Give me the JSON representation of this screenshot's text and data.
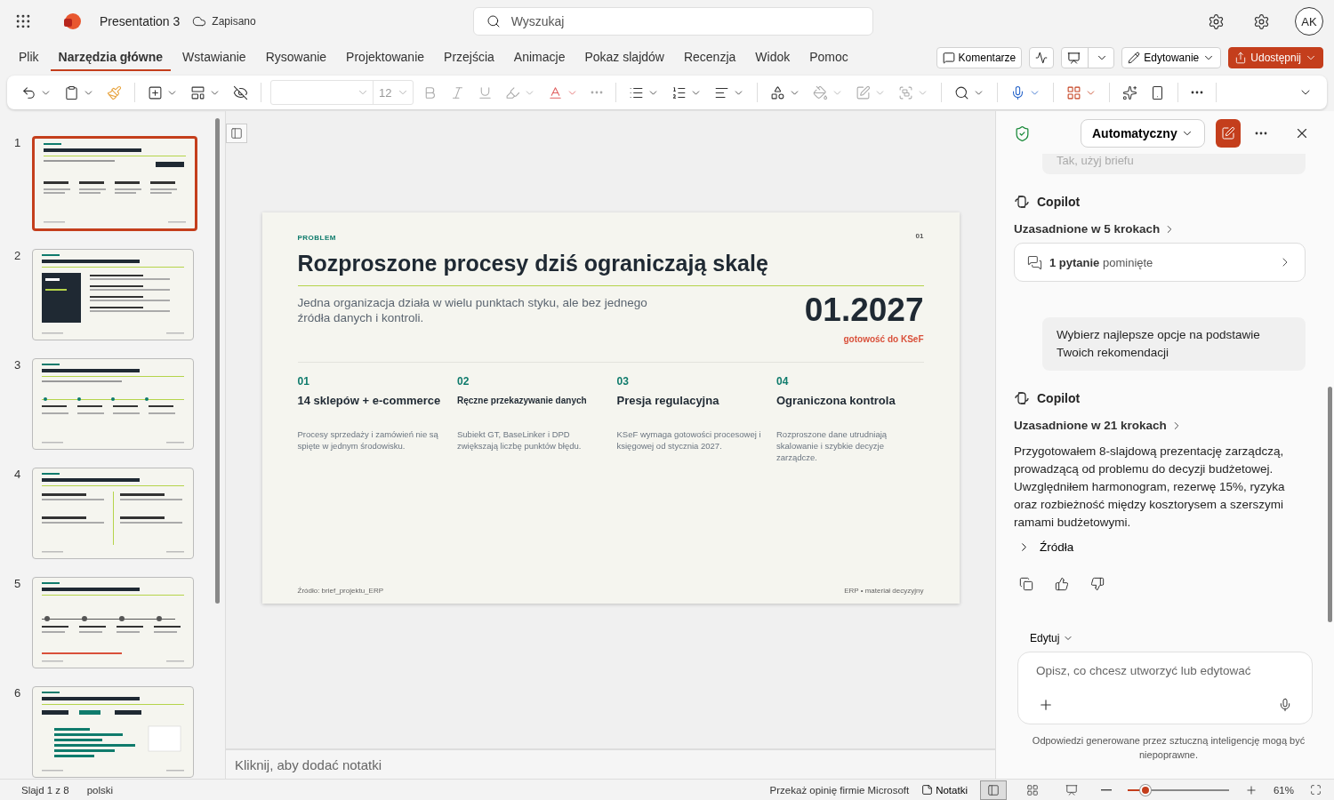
{
  "app": {
    "title": "Presentation 3",
    "save_status": "Zapisano",
    "search": {
      "placeholder": "Wyszukaj"
    },
    "avatar": "AK"
  },
  "menu_tabs": [
    {
      "label": "Plik",
      "selected": false
    },
    {
      "label": "Narzędzia główne",
      "selected": true
    },
    {
      "label": "Wstawianie",
      "selected": false
    },
    {
      "label": "Rysowanie",
      "selected": false
    },
    {
      "label": "Projektowanie",
      "selected": false
    },
    {
      "label": "Przejścia",
      "selected": false
    },
    {
      "label": "Animacje",
      "selected": false
    },
    {
      "label": "Pokaz slajdów",
      "selected": false
    },
    {
      "label": "Recenzja",
      "selected": false
    },
    {
      "label": "Widok",
      "selected": false
    },
    {
      "label": "Pomoc",
      "selected": false
    }
  ],
  "header_buttons": {
    "comments": "Komentarze",
    "mode": "Edytowanie",
    "share": "Udostępnij"
  },
  "toolbar": {
    "font_size": "12"
  },
  "slides": [
    {
      "number": "1",
      "selected": true
    },
    {
      "number": "2",
      "selected": false
    },
    {
      "number": "3",
      "selected": false
    },
    {
      "number": "4",
      "selected": false
    },
    {
      "number": "5",
      "selected": false
    },
    {
      "number": "6",
      "selected": false
    }
  ],
  "slide": {
    "label": "PROBLEM",
    "page": "01",
    "title": "Rozproszone procesy dziś ograniczają skalę",
    "subtitle": "Jedna organizacja działa w wielu punktach styku, ale bez jednego źródła danych i kontroli.",
    "big_number": "01.2027",
    "big_caption": "gotowość do KSeF",
    "columns": [
      {
        "kind": "regular",
        "number": "01",
        "title": "14 sklepów + e-commerce",
        "text": "Procesy sprzedaży i zamówień nie są spięte w jednym środowisku."
      },
      {
        "kind": "compact",
        "number": "02",
        "title": "Ręczne przekazywanie danych",
        "text": "Subiekt GT, BaseLinker i DPD zwiększają liczbę punktów błędu."
      },
      {
        "kind": "regular",
        "number": "03",
        "title": "Presja regulacyjna",
        "text": "KSeF wymaga gotowości procesowej i księgowej od stycznia 2027."
      },
      {
        "kind": "regular",
        "number": "04",
        "title": "Ograniczona kontrola",
        "text": "Rozproszone dane utrudniają skalowanie i szybkie decyzje zarządcze."
      }
    ],
    "footer_left": "Źródło: brief_projektu_ERP",
    "footer_right": "ERP • materiał decyzyjny"
  },
  "notes": {
    "placeholder": "Kliknij, aby dodać notatki"
  },
  "copilot": {
    "mode": "Automatyczny",
    "previous_message": "Tak, użyj briefu",
    "messages": [
      {
        "kind": "copilot",
        "author": "Copilot",
        "reasoning": "Uzasadnione w 5 krokach",
        "card": "**1 pytanie** pominięte"
      },
      {
        "kind": "user",
        "text": "Wybierz najlepsze opcje na podstawie Twoich rekomendacji"
      },
      {
        "kind": "copilot",
        "author": "Copilot",
        "reasoning": "Uzasadnione w 21 krokach",
        "text": "Przygotowałem 8-slajdową prezentację zarządczą, prowadzącą od problemu do decyzji budżetowej. Uwzględniłem harmonogram, rezerwę 15%, ryzyka oraz rozbieżność między kosztorysem a szerszymi ramami budżetowymi.",
        "sources": "Źródła"
      }
    ],
    "edit_mode": "Edytuj",
    "prompt": {
      "placeholder": "Opisz, co chcesz utworzyć lub edytować"
    },
    "disclaimer": "Odpowiedzi generowane przez sztuczną inteligencję mogą być niepoprawne."
  },
  "status_bar": {
    "slide_info": "Slajd 1 z 8",
    "language": "polski",
    "feedback": "Przekaż opinię firmie Microsoft",
    "notes": "Notatki",
    "zoom": {
      "level": 0.14
    },
    "zoom_text": "61%"
  }
}
